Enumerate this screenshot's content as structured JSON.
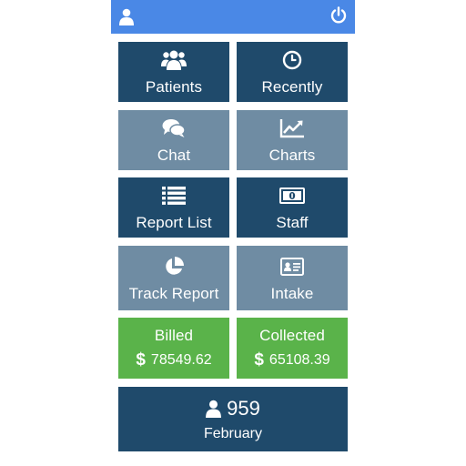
{
  "header": {
    "user_icon": "user-icon",
    "power_icon": "power-icon",
    "color": "#4a88e6"
  },
  "tiles": {
    "patients": {
      "label": "Patients",
      "icon": "users-group-icon"
    },
    "recently": {
      "label": "Recently",
      "icon": "clock-icon"
    },
    "chat": {
      "label": "Chat",
      "icon": "chat-bubbles-icon"
    },
    "charts": {
      "label": "Charts",
      "icon": "line-chart-icon"
    },
    "report_list": {
      "label": "Report List",
      "icon": "list-icon"
    },
    "staff": {
      "label": "Staff",
      "icon": "money-bill-icon"
    },
    "track_report": {
      "label": "Track Report",
      "icon": "pie-chart-icon"
    },
    "intake": {
      "label": "Intake",
      "icon": "id-card-icon"
    }
  },
  "stats": {
    "billed": {
      "label": "Billed",
      "currency": "$",
      "amount": "78549.62"
    },
    "collected": {
      "label": "Collected",
      "currency": "$",
      "amount": "65108.39"
    },
    "summary": {
      "count": "959",
      "month": "February",
      "icon": "user-icon"
    }
  },
  "colors": {
    "dark_tile": "#1f4a6b",
    "gray_tile": "#6f8ca3",
    "green_tile": "#5ab34a"
  }
}
